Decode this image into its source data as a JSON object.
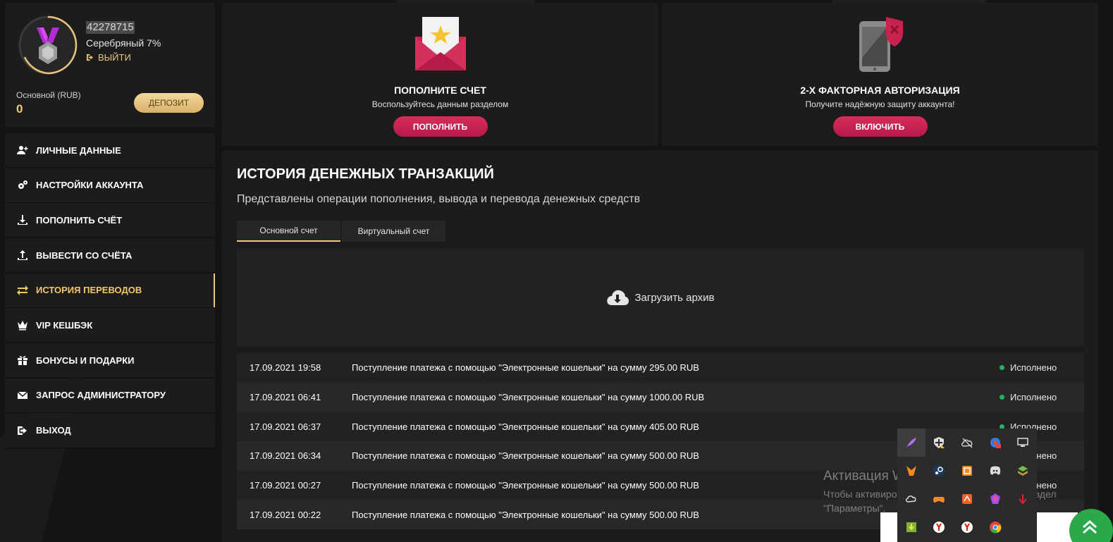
{
  "profile": {
    "user_id": "42278715",
    "level": "Серебряный 7%",
    "logout_label": "ВЫЙТИ",
    "balance_label": "Основной (RUB)",
    "balance_value": "0",
    "deposit_label": "ДЕПОЗИТ"
  },
  "menu": [
    {
      "label": "ЛИЧНЫЕ ДАННЫЕ",
      "icon": "user-plus-icon"
    },
    {
      "label": "НАСТРОЙКИ АККАУНТА",
      "icon": "gears-icon"
    },
    {
      "label": "ПОПОЛНИТЬ СЧЁТ",
      "icon": "download-icon"
    },
    {
      "label": "ВЫВЕСТИ СО СЧЁТА",
      "icon": "upload-icon"
    },
    {
      "label": "ИСТОРИЯ ПЕРЕВОДОВ",
      "icon": "exchange-icon",
      "active": true
    },
    {
      "label": "VIP КЕШБЭК",
      "icon": "crown-icon"
    },
    {
      "label": "БОНУСЫ И ПОДАРКИ",
      "icon": "gift-icon"
    },
    {
      "label": "ЗАПРОС АДМИНИСТРАТОРУ",
      "icon": "envelope-icon"
    },
    {
      "label": "ВЫХОД",
      "icon": "sign-out-icon"
    }
  ],
  "promo_deposit": {
    "title": "ПОПОЛНИТЕ СЧЕТ",
    "subtitle": "Воспользуйтесь данным разделом",
    "button": "ПОПОЛНИТЬ"
  },
  "promo_2fa": {
    "title": "2-Х ФАКТОРНАЯ АВТОРИЗАЦИЯ",
    "subtitle": "Получите надёжную защиту аккаунта!",
    "button": "ВКЛЮЧИТЬ"
  },
  "history": {
    "title": "ИСТОРИЯ ДЕНЕЖНЫХ ТРАНЗАКЦИЙ",
    "subtitle": "Представлены операции пополнения, вывода и перевода денежных средств",
    "tabs": [
      "Основной счет",
      "Виртуальный счет"
    ],
    "archive_label": "Загрузить архив",
    "rows": [
      {
        "date": "17.09.2021 19:58",
        "description": "Поступление платежа с помощью \"Электронные кошельки\" на сумму 295.00 RUB",
        "status": "Исполнено"
      },
      {
        "date": "17.09.2021 06:41",
        "description": "Поступление платежа с помощью \"Электронные кошельки\" на сумму 1000.00 RUB",
        "status": "Исполнено"
      },
      {
        "date": "17.09.2021 06:37",
        "description": "Поступление платежа с помощью \"Электронные кошельки\" на сумму 405.00 RUB",
        "status": "Исполнено"
      },
      {
        "date": "17.09.2021 06:34",
        "description": "Поступление платежа с помощью \"Электронные кошельки\" на сумму 500.00 RUB",
        "status": "Исполнено"
      },
      {
        "date": "17.09.2021 00:27",
        "description": "Поступление платежа с помощью \"Электронные кошельки\" на сумму 500.00 RUB",
        "status": "Исполнено"
      },
      {
        "date": "17.09.2021 00:22",
        "description": "Поступление платежа с помощью \"Электронные кошельки\" на сумму 500.00 RUB",
        "status": "Исполнено"
      }
    ]
  },
  "windows_activation": {
    "line1": "Активация Windows",
    "line2": "Чтобы активировать Windows, перейдите в раздел",
    "line3": "\"Параметры\"."
  },
  "colors": {
    "accent_gold": "#f0c96f",
    "accent_pink": "#c8234f",
    "status_green": "#22b45a",
    "panel": "#1c1c1c"
  }
}
